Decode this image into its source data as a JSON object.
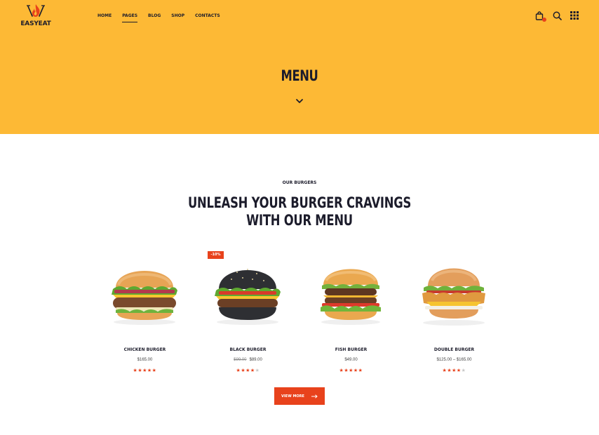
{
  "brand": {
    "name": "EASYEAT"
  },
  "nav": {
    "items": [
      {
        "label": "Home"
      },
      {
        "label": "Pages"
      },
      {
        "label": "Blog"
      },
      {
        "label": "Shop"
      },
      {
        "label": "Contacts"
      }
    ],
    "active": "Pages"
  },
  "header_icons": {
    "cart": "shopping-bag-icon",
    "search": "search-icon",
    "menu": "grid-menu-icon",
    "cart_badge": ""
  },
  "hero": {
    "title": "MENU",
    "scroll_icon": "chevron-down-icon"
  },
  "section": {
    "eyebrow": "Our Burgers",
    "title_line1": "Unleash your burger cravings",
    "title_line2": "with our menu"
  },
  "products": [
    {
      "name": "Chicken Burger",
      "price": "$165.00",
      "old_price": "",
      "rating": 5,
      "badge": ""
    },
    {
      "name": "Black Burger",
      "price": "$89.00",
      "old_price": "$99.00",
      "rating": 4,
      "badge": "-10%"
    },
    {
      "name": "Fish Burger",
      "price": "$49.00",
      "old_price": "",
      "rating": 5,
      "badge": ""
    },
    {
      "name": "Double Burger",
      "price": "$125.00 – $165.00",
      "old_price": "",
      "rating": 4,
      "badge": ""
    }
  ],
  "cta": {
    "label": "View More",
    "icon": "arrow-right-icon"
  },
  "colors": {
    "accent": "#e8421c",
    "hero_bg": "#fdb935",
    "text": "#1c1c2b"
  }
}
